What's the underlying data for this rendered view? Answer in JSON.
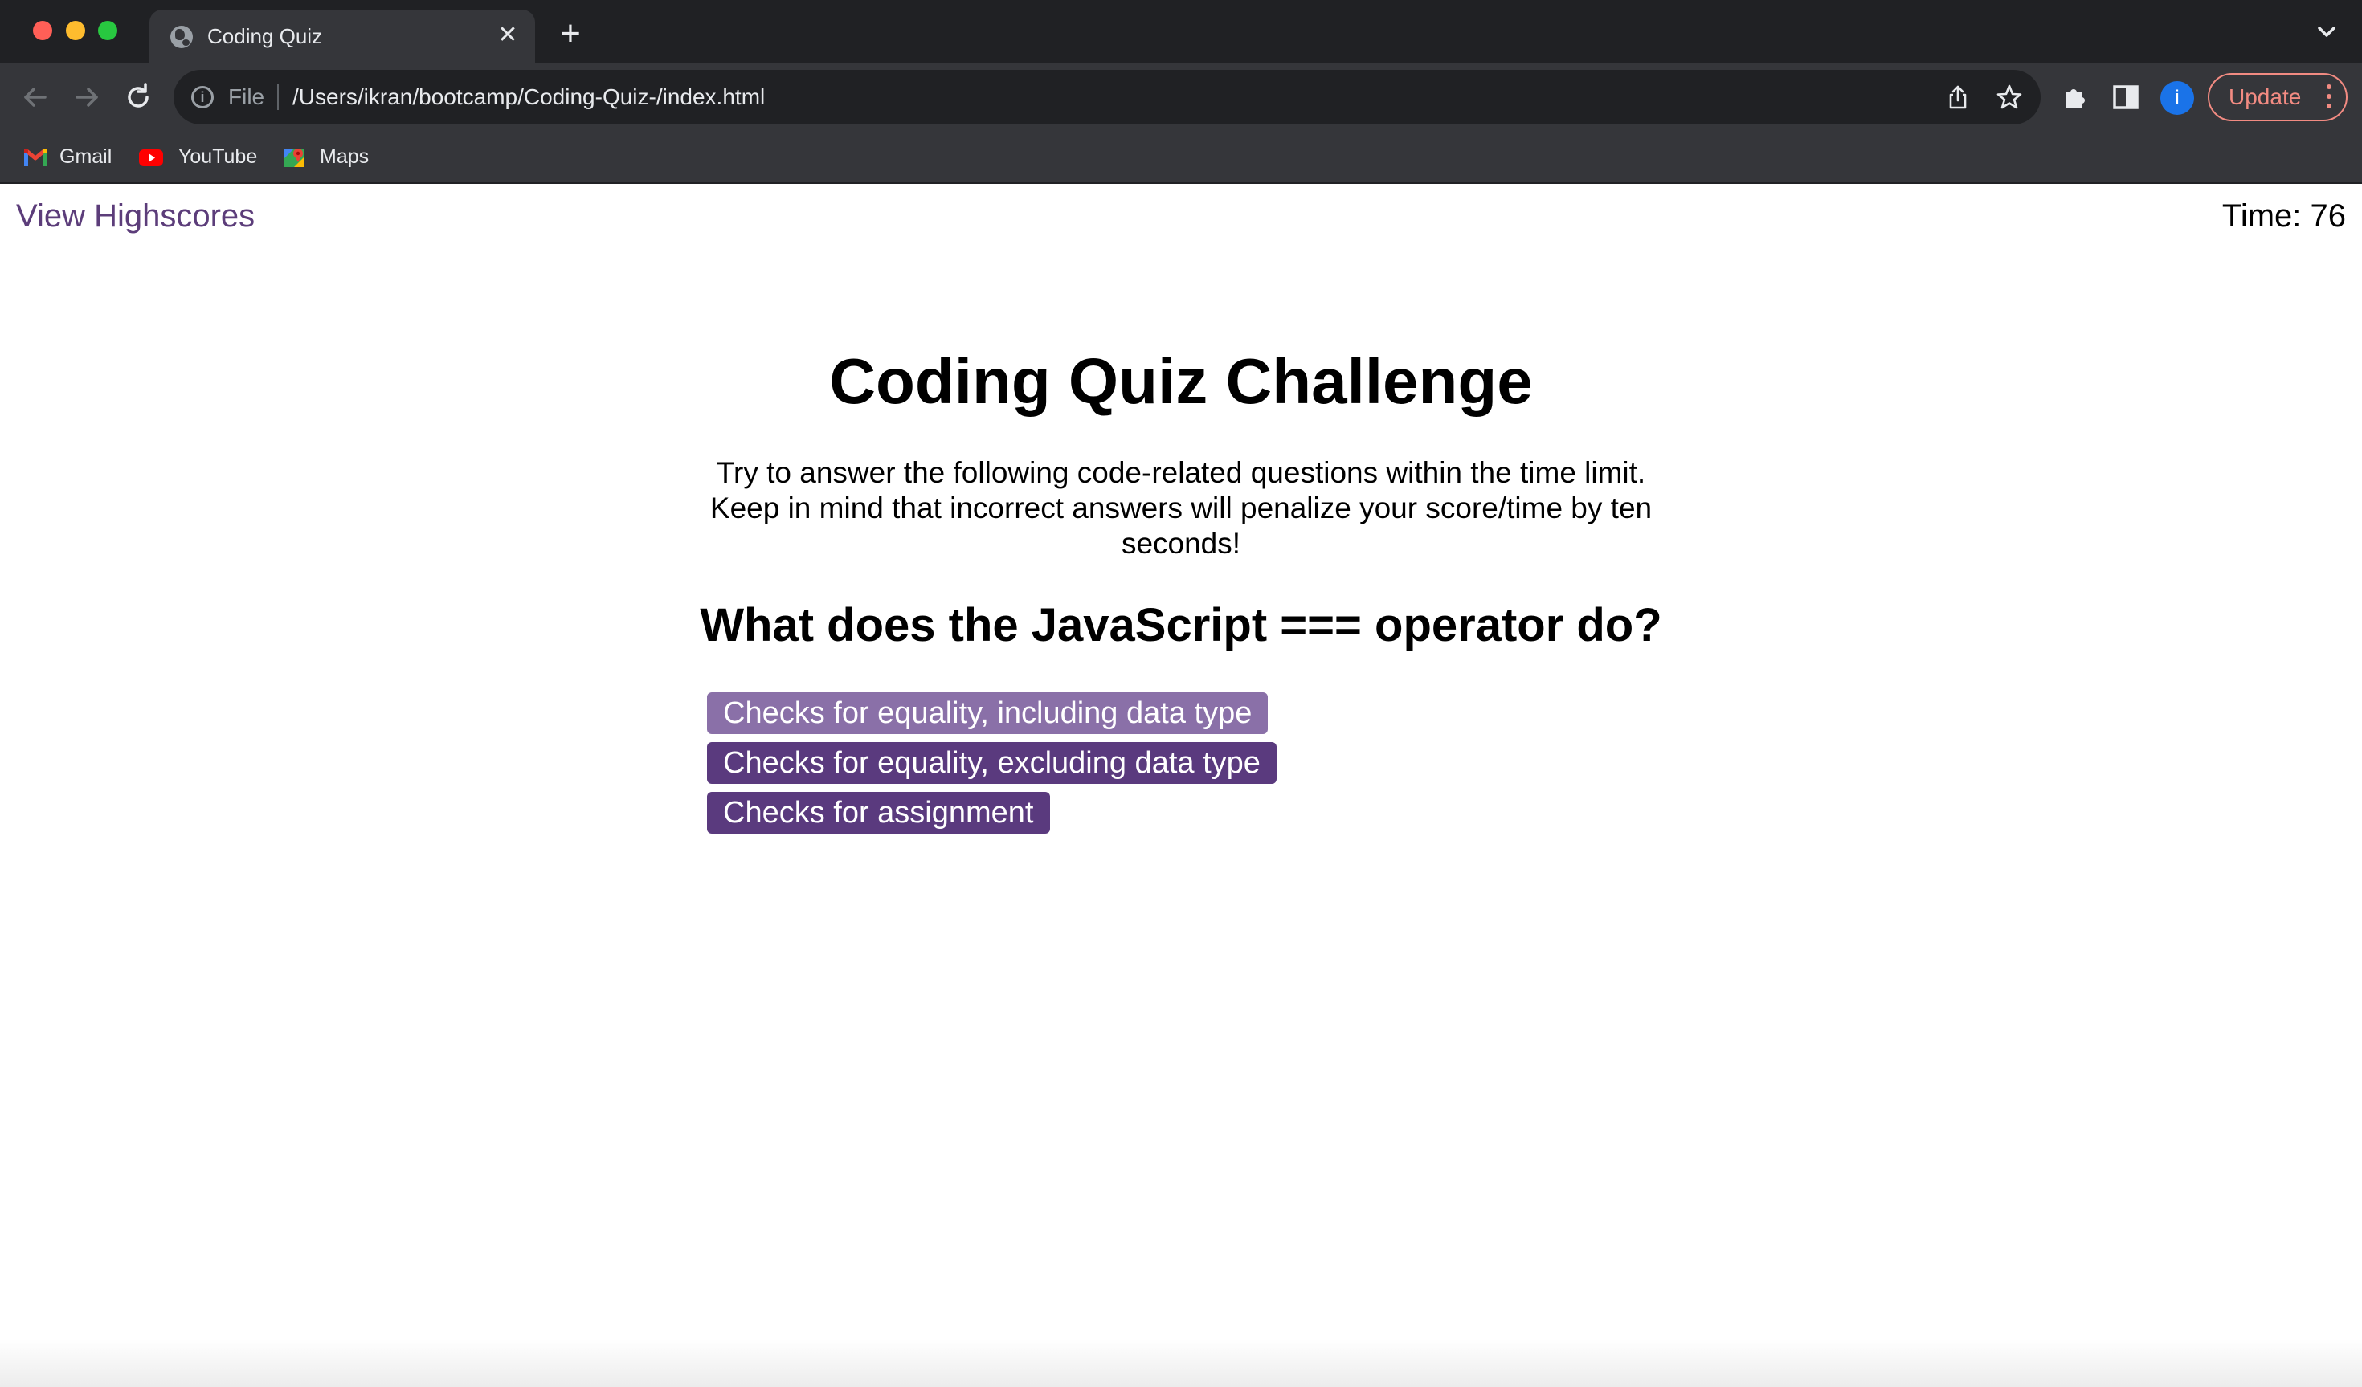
{
  "browser": {
    "tab_title": "Coding Quiz",
    "url_scheme": "File",
    "url": "/Users/ikran/bootcamp/Coding-Quiz-/index.html",
    "update_label": "Update",
    "profile_initial": "i",
    "bookmarks": [
      {
        "label": "Gmail",
        "icon": "gmail-icon"
      },
      {
        "label": "YouTube",
        "icon": "youtube-icon"
      },
      {
        "label": "Maps",
        "icon": "maps-icon"
      }
    ]
  },
  "quiz": {
    "highscores_link": "View Highscores",
    "timer": "Time: 76",
    "title": "Coding Quiz Challenge",
    "intro": "Try to answer the following code-related questions within the time limit. Keep in mind that incorrect answers will penalize your score/time by ten seconds!",
    "question": "What does the JavaScript === operator do?",
    "answers": [
      "Checks for equality, including data type",
      "Checks for equality, excluding data type",
      "Checks for assignment"
    ]
  },
  "colors": {
    "accent": "#5a3a7e",
    "accent_hover": "#8a70a8",
    "link": "#5c3d7a"
  }
}
